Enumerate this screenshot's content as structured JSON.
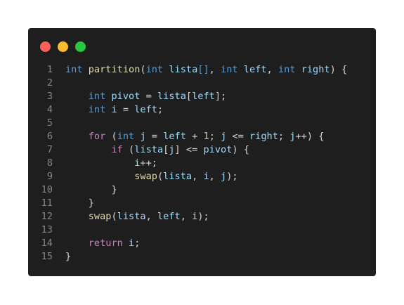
{
  "window": {
    "controls": {
      "close_color": "#ff5f56",
      "minimize_color": "#ffbd2e",
      "maximize_color": "#27c93f"
    }
  },
  "code": {
    "language": "C",
    "theme_colors": {
      "background": "#1e1e1e",
      "type_keyword": "#569cd6",
      "control_keyword": "#c586c0",
      "function": "#dcdcaa",
      "variable": "#9cdcfe",
      "number": "#b5cea8",
      "line_number": "#858585"
    },
    "lines": [
      {
        "n": "1",
        "tokens": [
          [
            "kw-type",
            "int"
          ],
          [
            "plain",
            " "
          ],
          [
            "fn",
            "partition"
          ],
          [
            "plain",
            "("
          ],
          [
            "kw-type",
            "int"
          ],
          [
            "plain",
            " "
          ],
          [
            "var",
            "lista"
          ],
          [
            "kw-type",
            "[]"
          ],
          [
            "plain",
            ", "
          ],
          [
            "kw-type",
            "int"
          ],
          [
            "plain",
            " "
          ],
          [
            "var",
            "left"
          ],
          [
            "plain",
            ", "
          ],
          [
            "kw-type",
            "int"
          ],
          [
            "plain",
            " "
          ],
          [
            "var",
            "right"
          ],
          [
            "plain",
            ") {"
          ]
        ]
      },
      {
        "n": "2",
        "tokens": []
      },
      {
        "n": "3",
        "tokens": [
          [
            "plain",
            "    "
          ],
          [
            "kw-type",
            "int"
          ],
          [
            "plain",
            " "
          ],
          [
            "var",
            "pivot"
          ],
          [
            "plain",
            " = "
          ],
          [
            "var",
            "lista"
          ],
          [
            "plain",
            "["
          ],
          [
            "var",
            "left"
          ],
          [
            "plain",
            "];"
          ]
        ]
      },
      {
        "n": "4",
        "tokens": [
          [
            "plain",
            "    "
          ],
          [
            "kw-type",
            "int"
          ],
          [
            "plain",
            " "
          ],
          [
            "var",
            "i"
          ],
          [
            "plain",
            " = "
          ],
          [
            "var",
            "left"
          ],
          [
            "plain",
            ";"
          ]
        ]
      },
      {
        "n": "5",
        "tokens": []
      },
      {
        "n": "6",
        "tokens": [
          [
            "plain",
            "    "
          ],
          [
            "kw-ctrl",
            "for"
          ],
          [
            "plain",
            " ("
          ],
          [
            "kw-type",
            "int"
          ],
          [
            "plain",
            " "
          ],
          [
            "var",
            "j"
          ],
          [
            "plain",
            " = "
          ],
          [
            "var",
            "left"
          ],
          [
            "plain",
            " + "
          ],
          [
            "num",
            "1"
          ],
          [
            "plain",
            "; "
          ],
          [
            "var",
            "j"
          ],
          [
            "plain",
            " <= "
          ],
          [
            "var",
            "right"
          ],
          [
            "plain",
            "; "
          ],
          [
            "var",
            "j"
          ],
          [
            "plain",
            "++) {"
          ]
        ]
      },
      {
        "n": "7",
        "tokens": [
          [
            "plain",
            "        "
          ],
          [
            "kw-ctrl",
            "if"
          ],
          [
            "plain",
            " ("
          ],
          [
            "var",
            "lista"
          ],
          [
            "plain",
            "["
          ],
          [
            "var",
            "j"
          ],
          [
            "plain",
            "] <= "
          ],
          [
            "var",
            "pivot"
          ],
          [
            "plain",
            ") {"
          ]
        ]
      },
      {
        "n": "8",
        "tokens": [
          [
            "plain",
            "            "
          ],
          [
            "var",
            "i"
          ],
          [
            "plain",
            "++;"
          ]
        ]
      },
      {
        "n": "9",
        "tokens": [
          [
            "plain",
            "            "
          ],
          [
            "fn",
            "swap"
          ],
          [
            "plain",
            "("
          ],
          [
            "var",
            "lista"
          ],
          [
            "plain",
            ", "
          ],
          [
            "var",
            "i"
          ],
          [
            "plain",
            ", "
          ],
          [
            "var",
            "j"
          ],
          [
            "plain",
            ");"
          ]
        ]
      },
      {
        "n": "10",
        "tokens": [
          [
            "plain",
            "        }"
          ]
        ]
      },
      {
        "n": "11",
        "tokens": [
          [
            "plain",
            "    }"
          ]
        ]
      },
      {
        "n": "12",
        "tokens": [
          [
            "plain",
            "    "
          ],
          [
            "fn",
            "swap"
          ],
          [
            "plain",
            "("
          ],
          [
            "var",
            "lista"
          ],
          [
            "plain",
            ", "
          ],
          [
            "var",
            "left"
          ],
          [
            "plain",
            ", "
          ],
          [
            "var",
            "i"
          ],
          [
            "plain",
            ");"
          ]
        ]
      },
      {
        "n": "13",
        "tokens": []
      },
      {
        "n": "14",
        "tokens": [
          [
            "plain",
            "    "
          ],
          [
            "kw-ctrl",
            "return"
          ],
          [
            "plain",
            " "
          ],
          [
            "var",
            "i"
          ],
          [
            "plain",
            ";"
          ]
        ]
      },
      {
        "n": "15",
        "tokens": [
          [
            "plain",
            "}"
          ]
        ]
      }
    ]
  }
}
